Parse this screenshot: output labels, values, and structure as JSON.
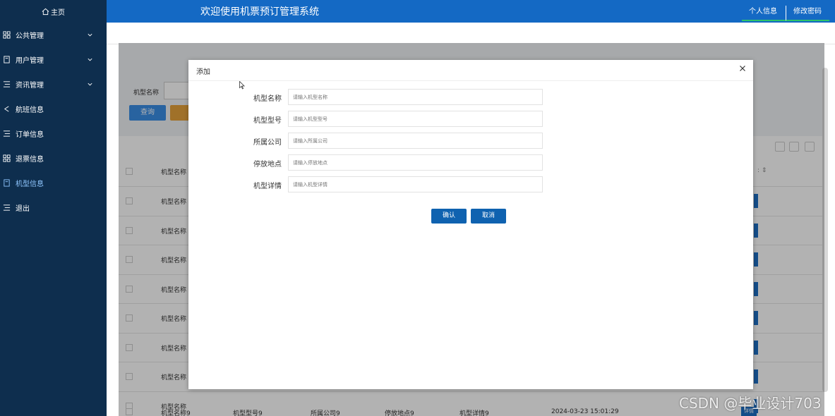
{
  "sidebar": {
    "home_label": "主页",
    "items": [
      {
        "label": "公共管理",
        "icon": "grid-icon",
        "has_chevron": true
      },
      {
        "label": "用户管理",
        "icon": "book-icon",
        "has_chevron": true
      },
      {
        "label": "资讯管理",
        "icon": "list-icon",
        "has_chevron": true
      },
      {
        "label": "航班信息",
        "icon": "share-icon",
        "has_chevron": false
      },
      {
        "label": "订单信息",
        "icon": "list-icon",
        "has_chevron": false
      },
      {
        "label": "退票信息",
        "icon": "grid-icon",
        "has_chevron": false
      },
      {
        "label": "机型信息",
        "icon": "book-icon",
        "has_chevron": false,
        "active": true
      },
      {
        "label": "退出",
        "icon": "list-icon",
        "has_chevron": false
      }
    ]
  },
  "header": {
    "title": "欢迎使用机票预订管理系统",
    "profile_label": "个人信息",
    "password_label": "修改密码"
  },
  "search": {
    "label": "机型名称",
    "query_button": "查询"
  },
  "table": {
    "header_col1": "机型名称",
    "row_col1": "机型名称",
    "last_row": {
      "name": "机型名称9",
      "model": "机型型号9",
      "company": "所属公司9",
      "location": "停放地点9",
      "details": "机型详情9",
      "time": "2024-03-23 15:01:29",
      "action": "详情"
    }
  },
  "modal": {
    "title": "添加",
    "fields": [
      {
        "label": "机型名称",
        "placeholder": "请输入机型名称"
      },
      {
        "label": "机型型号",
        "placeholder": "请输入机型型号"
      },
      {
        "label": "所属公司",
        "placeholder": "请输入所属公司"
      },
      {
        "label": "停放地点",
        "placeholder": "请输入停放地点"
      },
      {
        "label": "机型详情",
        "placeholder": "请输入机型详情"
      }
    ],
    "ok_label": "确认",
    "cancel_label": "取消"
  },
  "watermark": "CSDN @毕业设计703",
  "colors": {
    "sidebar": "#0e2e4e",
    "header": "#1469c4",
    "primary_button": "#0f62b0",
    "active_menu": "#8fc6ff"
  }
}
